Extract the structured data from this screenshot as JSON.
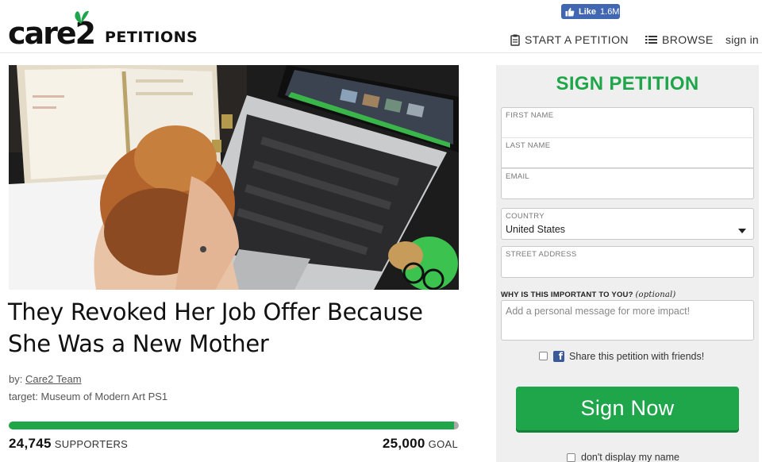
{
  "facebook": {
    "like_label": "Like",
    "like_count": "1.6M"
  },
  "header": {
    "brand": "care2",
    "product": "PETITIONS",
    "nav_start": "START A PETITION",
    "nav_browse": "BROWSE",
    "nav_signin": "sign in"
  },
  "petition": {
    "title": "They Revoked Her Job Offer Because She Was a New Mother",
    "by_prefix": "by:",
    "author": "Care2 Team",
    "target_prefix": "target:",
    "target": "Museum of Modern Art PS1",
    "supporters_count": "24,745",
    "supporters_label": "SUPPORTERS",
    "goal_count": "25,000",
    "goal_label": "GOAL",
    "progress_fraction": 0.9898
  },
  "form": {
    "title": "SIGN PETITION",
    "first_name_label": "FIRST NAME",
    "last_name_label": "LAST NAME",
    "email_label": "EMAIL",
    "country_label": "COUNTRY",
    "country_value": "United States",
    "street_label": "STREET ADDRESS",
    "why_label": "WHY IS THIS IMPORTANT TO YOU?",
    "why_optional": "(optional)",
    "why_placeholder": "Add a personal message for more impact!",
    "share_label": "Share this petition with friends!",
    "sign_button": "Sign Now",
    "dont_display": "don't display my name"
  },
  "colors": {
    "brand_green": "#1fa64b",
    "facebook_blue": "#4267b2"
  }
}
